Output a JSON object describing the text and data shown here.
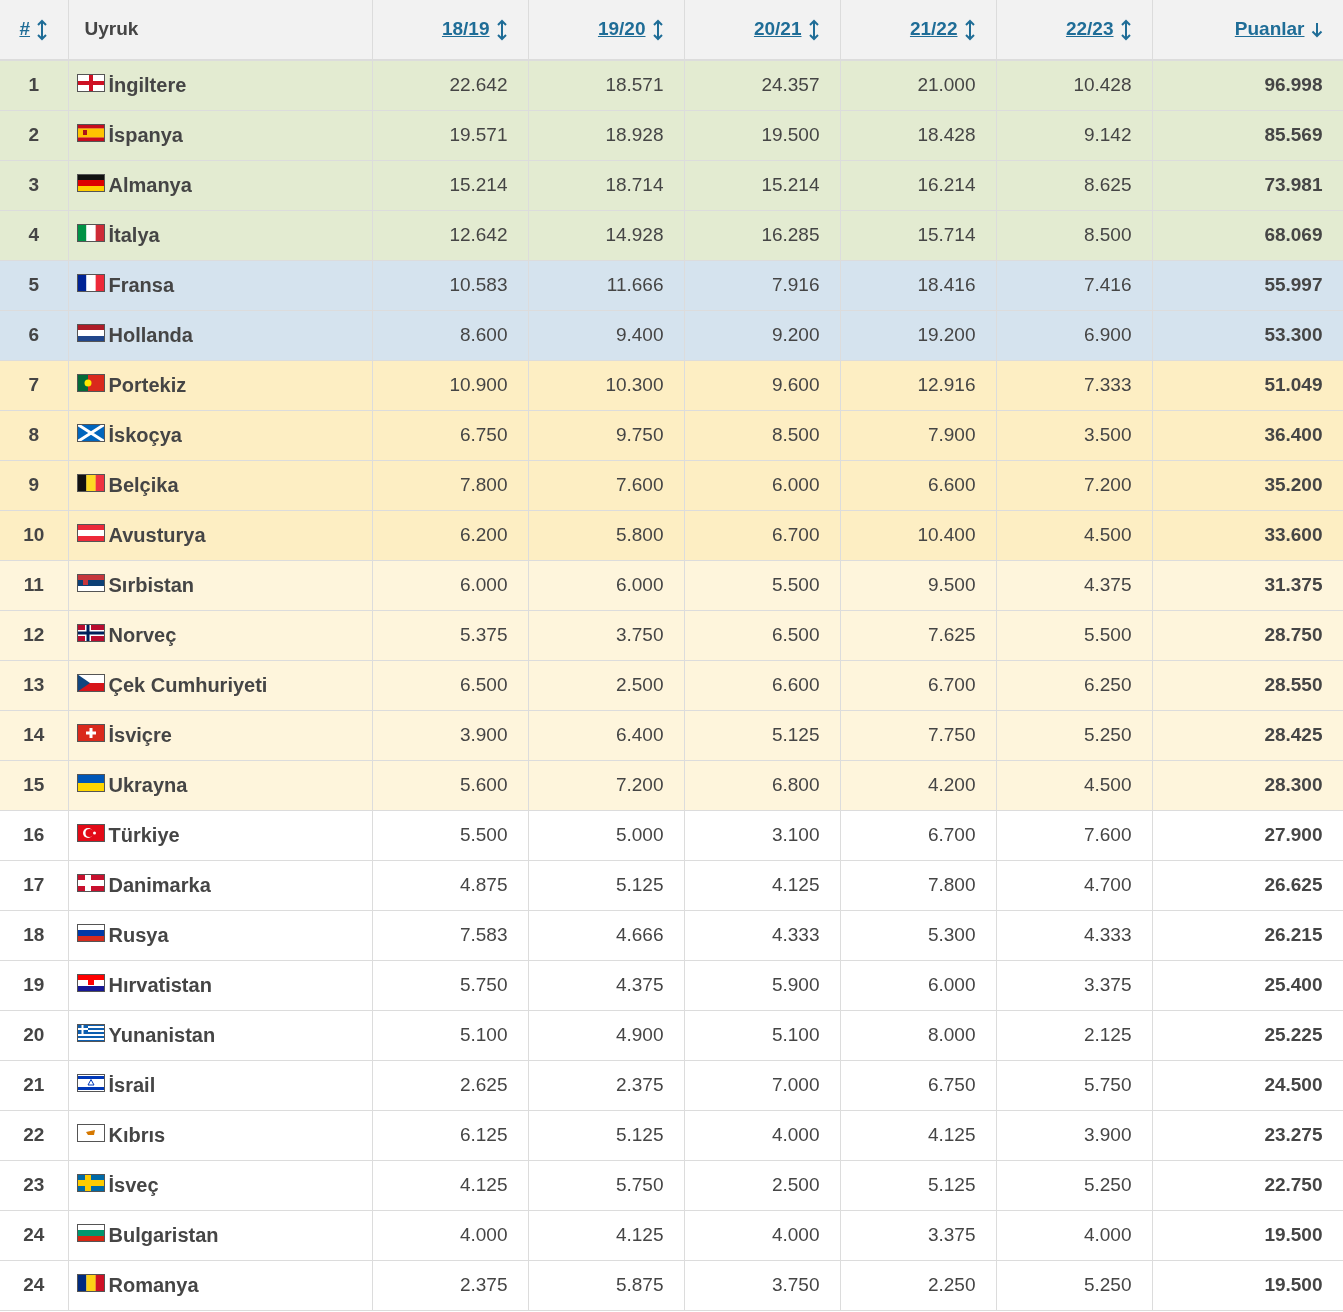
{
  "table": {
    "columns": [
      {
        "label": "#",
        "kind": "sortable"
      },
      {
        "label": "Uyruk",
        "kind": "plain"
      },
      {
        "label": "18/19",
        "kind": "sortable"
      },
      {
        "label": "19/20",
        "kind": "sortable"
      },
      {
        "label": "20/21",
        "kind": "sortable"
      },
      {
        "label": "21/22",
        "kind": "sortable"
      },
      {
        "label": "22/23",
        "kind": "sortable"
      },
      {
        "label": "Puanlar",
        "kind": "sorted"
      }
    ],
    "rows": [
      {
        "rank": "1",
        "country": "İngiltere",
        "values": [
          "22.642",
          "18.571",
          "24.357",
          "21.000",
          "10.428"
        ],
        "points": "96.998",
        "color": "#e3ebd1"
      },
      {
        "rank": "2",
        "country": "İspanya",
        "values": [
          "19.571",
          "18.928",
          "19.500",
          "18.428",
          "9.142"
        ],
        "points": "85.569",
        "color": "#e3ebd1"
      },
      {
        "rank": "3",
        "country": "Almanya",
        "values": [
          "15.214",
          "18.714",
          "15.214",
          "16.214",
          "8.625"
        ],
        "points": "73.981",
        "color": "#e3ebd1"
      },
      {
        "rank": "4",
        "country": "İtalya",
        "values": [
          "12.642",
          "14.928",
          "16.285",
          "15.714",
          "8.500"
        ],
        "points": "68.069",
        "color": "#e3ebd1"
      },
      {
        "rank": "5",
        "country": "Fransa",
        "values": [
          "10.583",
          "11.666",
          "7.916",
          "18.416",
          "7.416"
        ],
        "points": "55.997",
        "color": "#d5e3ee"
      },
      {
        "rank": "6",
        "country": "Hollanda",
        "values": [
          "8.600",
          "9.400",
          "9.200",
          "19.200",
          "6.900"
        ],
        "points": "53.300",
        "color": "#d5e3ee"
      },
      {
        "rank": "7",
        "country": "Portekiz",
        "values": [
          "10.900",
          "10.300",
          "9.600",
          "12.916",
          "7.333"
        ],
        "points": "51.049",
        "color": "#fdeec3"
      },
      {
        "rank": "8",
        "country": "İskoçya",
        "values": [
          "6.750",
          "9.750",
          "8.500",
          "7.900",
          "3.500"
        ],
        "points": "36.400",
        "color": "#fdeec3"
      },
      {
        "rank": "9",
        "country": "Belçika",
        "values": [
          "7.800",
          "7.600",
          "6.000",
          "6.600",
          "7.200"
        ],
        "points": "35.200",
        "color": "#fdeec3"
      },
      {
        "rank": "10",
        "country": "Avusturya",
        "values": [
          "6.200",
          "5.800",
          "6.700",
          "10.400",
          "4.500"
        ],
        "points": "33.600",
        "color": "#fdeec3"
      },
      {
        "rank": "11",
        "country": "Sırbistan",
        "values": [
          "6.000",
          "6.000",
          "5.500",
          "9.500",
          "4.375"
        ],
        "points": "31.375",
        "color": "#fef5dc"
      },
      {
        "rank": "12",
        "country": "Norveç",
        "values": [
          "5.375",
          "3.750",
          "6.500",
          "7.625",
          "5.500"
        ],
        "points": "28.750",
        "color": "#fef5dc"
      },
      {
        "rank": "13",
        "country": "Çek Cumhuriyeti",
        "values": [
          "6.500",
          "2.500",
          "6.600",
          "6.700",
          "6.250"
        ],
        "points": "28.550",
        "color": "#fef5dc"
      },
      {
        "rank": "14",
        "country": "İsviçre",
        "values": [
          "3.900",
          "6.400",
          "5.125",
          "7.750",
          "5.250"
        ],
        "points": "28.425",
        "color": "#fef5dc"
      },
      {
        "rank": "15",
        "country": "Ukrayna",
        "values": [
          "5.600",
          "7.200",
          "6.800",
          "4.200",
          "4.500"
        ],
        "points": "28.300",
        "color": "#fef5dc"
      },
      {
        "rank": "16",
        "country": "Türkiye",
        "values": [
          "5.500",
          "5.000",
          "3.100",
          "6.700",
          "7.600"
        ],
        "points": "27.900",
        "color": "#ffffff"
      },
      {
        "rank": "17",
        "country": "Danimarka",
        "values": [
          "4.875",
          "5.125",
          "4.125",
          "7.800",
          "4.700"
        ],
        "points": "26.625",
        "color": "#ffffff"
      },
      {
        "rank": "18",
        "country": "Rusya",
        "values": [
          "7.583",
          "4.666",
          "4.333",
          "5.300",
          "4.333"
        ],
        "points": "26.215",
        "color": "#ffffff"
      },
      {
        "rank": "19",
        "country": "Hırvatistan",
        "values": [
          "5.750",
          "4.375",
          "5.900",
          "6.000",
          "3.375"
        ],
        "points": "25.400",
        "color": "#ffffff"
      },
      {
        "rank": "20",
        "country": "Yunanistan",
        "values": [
          "5.100",
          "4.900",
          "5.100",
          "8.000",
          "2.125"
        ],
        "points": "25.225",
        "color": "#ffffff"
      },
      {
        "rank": "21",
        "country": "İsrail",
        "values": [
          "2.625",
          "2.375",
          "7.000",
          "6.750",
          "5.750"
        ],
        "points": "24.500",
        "color": "#ffffff"
      },
      {
        "rank": "22",
        "country": "Kıbrıs",
        "values": [
          "6.125",
          "5.125",
          "4.000",
          "4.125",
          "3.900"
        ],
        "points": "23.275",
        "color": "#ffffff"
      },
      {
        "rank": "23",
        "country": "İsveç",
        "values": [
          "4.125",
          "5.750",
          "2.500",
          "5.125",
          "5.250"
        ],
        "points": "22.750",
        "color": "#ffffff"
      },
      {
        "rank": "24",
        "country": "Bulgaristan",
        "values": [
          "4.000",
          "4.125",
          "4.000",
          "3.375",
          "4.000"
        ],
        "points": "19.500",
        "color": "#ffffff"
      },
      {
        "rank": "24",
        "country": "Romanya",
        "values": [
          "2.375",
          "5.875",
          "3.750",
          "2.250",
          "5.250"
        ],
        "points": "19.500",
        "color": "#ffffff"
      }
    ]
  }
}
